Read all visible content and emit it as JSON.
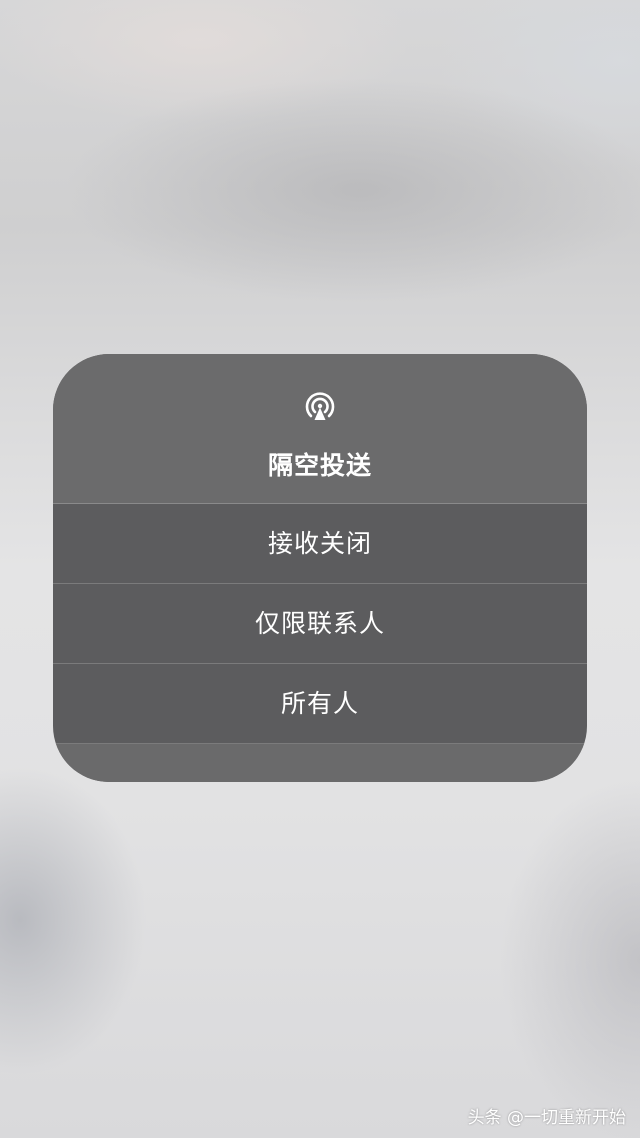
{
  "airdrop_panel": {
    "icon": "airdrop-icon",
    "title": "隔空投送",
    "options": [
      {
        "label": "接收关闭"
      },
      {
        "label": "仅限联系人"
      },
      {
        "label": "所有人"
      }
    ]
  },
  "watermark": "头条 @一切重新开始",
  "colors": {
    "panel": "#5c5c5e",
    "panel_header": "#6b6b6c",
    "text": "#ffffff"
  }
}
